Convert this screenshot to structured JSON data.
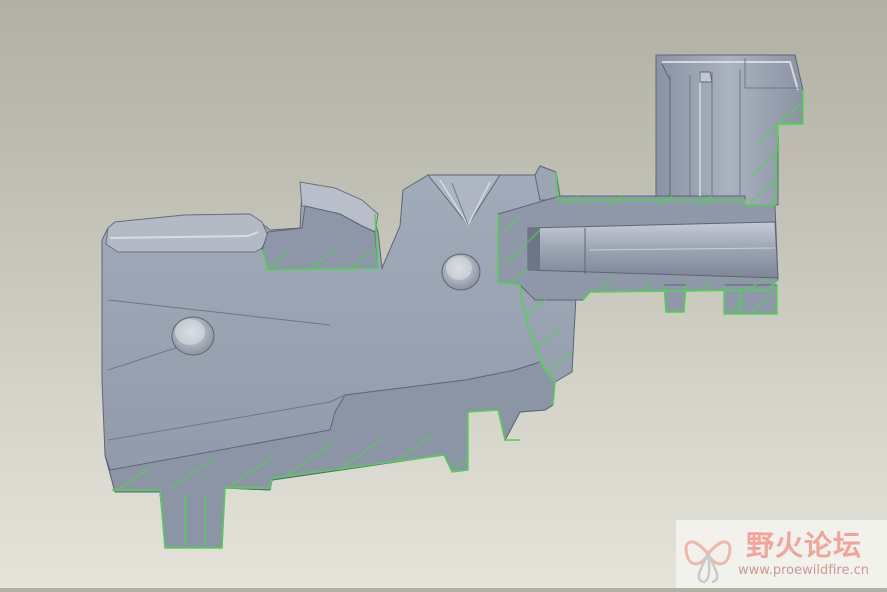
{
  "colors": {
    "part_face": "#9aa3b2",
    "part_dark": "#707a8a",
    "part_light": "#c7cdd7",
    "section_edge": "#4cd64c",
    "watermark_text": "#f0a49a"
  },
  "watermark": {
    "title": "野火论坛",
    "url": "www.proewildfire.cn",
    "icon": "butterfly-logo-icon"
  }
}
